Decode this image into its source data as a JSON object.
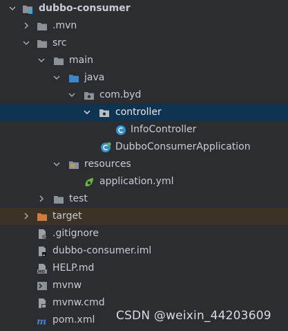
{
  "tree": {
    "root": "dubbo-consumer",
    "mvn": ".mvn",
    "src": "src",
    "main": "main",
    "java": "java",
    "package": "com.byd",
    "controller": "controller",
    "info_controller": "InfoController",
    "application_class": "DubboConsumerApplication",
    "resources": "resources",
    "application_yml": "application.yml",
    "test": "test",
    "target": "target",
    "gitignore": ".gitignore",
    "iml": "dubbo-consumer.iml",
    "help": "HELP.md",
    "mvnw": "mvnw",
    "mvnw_cmd": "mvnw.cmd",
    "pom": "pom.xml"
  },
  "icons": {
    "folder": "folder-icon",
    "module": "module-folder-icon",
    "package": "package-icon",
    "class": "class-icon",
    "spring_boot": "spring-boot-class-icon",
    "resources": "resources-folder-icon",
    "yml": "yml-file-icon",
    "target": "excluded-folder-icon",
    "file": "file-icon",
    "markdown": "markdown-icon",
    "shell": "shell-icon",
    "maven": "maven-icon"
  },
  "colors": {
    "background": "#2b2d30",
    "selected_row": "#0e3451",
    "target_row": "#3d3226",
    "folder": "#8a9199",
    "class_icon": "#3592c4",
    "target_folder": "#d17c3b",
    "maven": "#4b7fd1"
  },
  "watermark": "CSDN @weixin_44203609"
}
